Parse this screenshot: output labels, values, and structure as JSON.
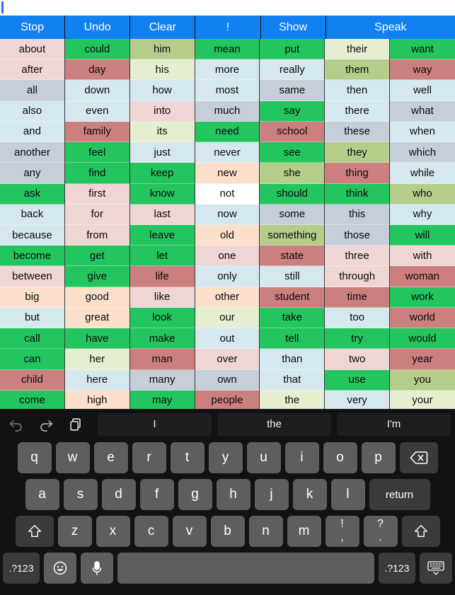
{
  "textentry": {
    "value": "",
    "placeholder": ""
  },
  "commandbar": {
    "buttons": [
      {
        "label": "Stop",
        "name": "stop",
        "flex": 1
      },
      {
        "label": "Undo",
        "name": "undo",
        "flex": 1
      },
      {
        "label": "Clear",
        "name": "clear",
        "flex": 1
      },
      {
        "label": "!",
        "name": "exclaim",
        "flex": 1
      },
      {
        "label": "Show",
        "name": "show",
        "flex": 1
      },
      {
        "label": "Speak",
        "name": "speak",
        "flex": 2
      }
    ],
    "background": "#1180f0",
    "text_color": "#ffffff"
  },
  "palette": {
    "green": "#22c55e",
    "olive": "#b5cd8a",
    "paleyellow": "#e6eed0",
    "paleblue": "#d6e8ef",
    "bluegray": "#c5ced9",
    "pink": "#f0d5d5",
    "rose": "#cc7f7f",
    "peach": "#fce0cc",
    "white": "#ffffff"
  },
  "grid": {
    "columns": [
      {
        "cells": [
          {
            "w": "about",
            "c": "pink"
          },
          {
            "w": "after",
            "c": "pink"
          },
          {
            "w": "all",
            "c": "bluegray"
          },
          {
            "w": "also",
            "c": "paleblue"
          },
          {
            "w": "and",
            "c": "paleblue"
          },
          {
            "w": "another",
            "c": "bluegray"
          },
          {
            "w": "any",
            "c": "bluegray"
          },
          {
            "w": "ask",
            "c": "green"
          },
          {
            "w": "back",
            "c": "paleblue"
          },
          {
            "w": "because",
            "c": "paleblue"
          },
          {
            "w": "become",
            "c": "green"
          },
          {
            "w": "between",
            "c": "pink"
          },
          {
            "w": "big",
            "c": "peach"
          },
          {
            "w": "but",
            "c": "paleblue"
          },
          {
            "w": "call",
            "c": "green"
          },
          {
            "w": "can",
            "c": "green"
          },
          {
            "w": "child",
            "c": "rose"
          },
          {
            "w": "come",
            "c": "green"
          }
        ]
      },
      {
        "cells": [
          {
            "w": "could",
            "c": "green"
          },
          {
            "w": "day",
            "c": "rose"
          },
          {
            "w": "down",
            "c": "paleblue"
          },
          {
            "w": "even",
            "c": "paleblue"
          },
          {
            "w": "family",
            "c": "rose"
          },
          {
            "w": "feel",
            "c": "green"
          },
          {
            "w": "find",
            "c": "green"
          },
          {
            "w": "first",
            "c": "pink"
          },
          {
            "w": "for",
            "c": "pink"
          },
          {
            "w": "from",
            "c": "pink"
          },
          {
            "w": "get",
            "c": "green"
          },
          {
            "w": "give",
            "c": "green"
          },
          {
            "w": "good",
            "c": "peach"
          },
          {
            "w": "great",
            "c": "peach"
          },
          {
            "w": "have",
            "c": "green"
          },
          {
            "w": "her",
            "c": "paleyellow"
          },
          {
            "w": "here",
            "c": "paleblue"
          },
          {
            "w": "high",
            "c": "peach"
          }
        ]
      },
      {
        "cells": [
          {
            "w": "him",
            "c": "olive"
          },
          {
            "w": "his",
            "c": "paleyellow"
          },
          {
            "w": "how",
            "c": "paleblue"
          },
          {
            "w": "into",
            "c": "pink"
          },
          {
            "w": "its",
            "c": "paleyellow"
          },
          {
            "w": "just",
            "c": "paleblue"
          },
          {
            "w": "keep",
            "c": "green"
          },
          {
            "w": "know",
            "c": "green"
          },
          {
            "w": "last",
            "c": "pink"
          },
          {
            "w": "leave",
            "c": "green"
          },
          {
            "w": "let",
            "c": "green"
          },
          {
            "w": "life",
            "c": "rose"
          },
          {
            "w": "like",
            "c": "pink"
          },
          {
            "w": "look",
            "c": "green"
          },
          {
            "w": "make",
            "c": "green"
          },
          {
            "w": "man",
            "c": "rose"
          },
          {
            "w": "many",
            "c": "bluegray"
          },
          {
            "w": "may",
            "c": "green"
          }
        ]
      },
      {
        "cells": [
          {
            "w": "mean",
            "c": "green"
          },
          {
            "w": "more",
            "c": "paleblue"
          },
          {
            "w": "most",
            "c": "paleblue"
          },
          {
            "w": "much",
            "c": "bluegray"
          },
          {
            "w": "need",
            "c": "green"
          },
          {
            "w": "never",
            "c": "paleblue"
          },
          {
            "w": "new",
            "c": "peach"
          },
          {
            "w": "not",
            "c": "white"
          },
          {
            "w": "now",
            "c": "paleblue"
          },
          {
            "w": "old",
            "c": "peach"
          },
          {
            "w": "one",
            "c": "pink"
          },
          {
            "w": "only",
            "c": "paleblue"
          },
          {
            "w": "other",
            "c": "peach"
          },
          {
            "w": "our",
            "c": "paleyellow"
          },
          {
            "w": "out",
            "c": "paleblue"
          },
          {
            "w": "over",
            "c": "pink"
          },
          {
            "w": "own",
            "c": "bluegray"
          },
          {
            "w": "people",
            "c": "rose"
          }
        ]
      },
      {
        "cells": [
          {
            "w": "put",
            "c": "green"
          },
          {
            "w": "really",
            "c": "paleblue"
          },
          {
            "w": "same",
            "c": "bluegray"
          },
          {
            "w": "say",
            "c": "green"
          },
          {
            "w": "school",
            "c": "rose"
          },
          {
            "w": "see",
            "c": "green"
          },
          {
            "w": "she",
            "c": "olive"
          },
          {
            "w": "should",
            "c": "green"
          },
          {
            "w": "some",
            "c": "bluegray"
          },
          {
            "w": "something",
            "c": "olive"
          },
          {
            "w": "state",
            "c": "rose"
          },
          {
            "w": "still",
            "c": "paleblue"
          },
          {
            "w": "student",
            "c": "rose"
          },
          {
            "w": "take",
            "c": "green"
          },
          {
            "w": "tell",
            "c": "green"
          },
          {
            "w": "than",
            "c": "paleblue"
          },
          {
            "w": "that",
            "c": "paleblue"
          },
          {
            "w": "the",
            "c": "paleyellow"
          }
        ]
      },
      {
        "cells": [
          {
            "w": "their",
            "c": "paleyellow"
          },
          {
            "w": "them",
            "c": "olive"
          },
          {
            "w": "then",
            "c": "paleblue"
          },
          {
            "w": "there",
            "c": "paleblue"
          },
          {
            "w": "these",
            "c": "bluegray"
          },
          {
            "w": "they",
            "c": "olive"
          },
          {
            "w": "thing",
            "c": "rose"
          },
          {
            "w": "think",
            "c": "green"
          },
          {
            "w": "this",
            "c": "bluegray"
          },
          {
            "w": "those",
            "c": "bluegray"
          },
          {
            "w": "three",
            "c": "pink"
          },
          {
            "w": "through",
            "c": "pink"
          },
          {
            "w": "time",
            "c": "rose"
          },
          {
            "w": "too",
            "c": "paleblue"
          },
          {
            "w": "try",
            "c": "green"
          },
          {
            "w": "two",
            "c": "pink"
          },
          {
            "w": "use",
            "c": "green"
          },
          {
            "w": "very",
            "c": "paleblue"
          }
        ]
      },
      {
        "cells": [
          {
            "w": "want",
            "c": "green"
          },
          {
            "w": "way",
            "c": "rose"
          },
          {
            "w": "well",
            "c": "paleblue"
          },
          {
            "w": "what",
            "c": "bluegray"
          },
          {
            "w": "when",
            "c": "paleblue"
          },
          {
            "w": "which",
            "c": "bluegray"
          },
          {
            "w": "while",
            "c": "paleblue"
          },
          {
            "w": "who",
            "c": "olive"
          },
          {
            "w": "why",
            "c": "paleblue"
          },
          {
            "w": "will",
            "c": "green"
          },
          {
            "w": "with",
            "c": "pink"
          },
          {
            "w": "woman",
            "c": "rose"
          },
          {
            "w": "work",
            "c": "green"
          },
          {
            "w": "world",
            "c": "rose"
          },
          {
            "w": "would",
            "c": "green"
          },
          {
            "w": "year",
            "c": "rose"
          },
          {
            "w": "you",
            "c": "olive"
          },
          {
            "w": "your",
            "c": "paleyellow"
          }
        ]
      }
    ]
  },
  "keyboard": {
    "tools": [
      {
        "name": "undo-icon",
        "label": "undo"
      },
      {
        "name": "redo-icon",
        "label": "redo"
      },
      {
        "name": "paste-icon",
        "label": "paste"
      }
    ],
    "predictions": [
      "I",
      "the",
      "I'm"
    ],
    "row1": [
      "q",
      "w",
      "e",
      "r",
      "t",
      "y",
      "u",
      "i",
      "o",
      "p"
    ],
    "row2": [
      "a",
      "s",
      "d",
      "f",
      "g",
      "h",
      "j",
      "k",
      "l"
    ],
    "return_label": "return",
    "row3": [
      "z",
      "x",
      "c",
      "v",
      "b",
      "n",
      "m"
    ],
    "punct1": {
      "top": "!",
      "bottom": ","
    },
    "punct2": {
      "top": "?",
      "bottom": "."
    },
    "numeric_label": ".?123",
    "numeric_label_right": ".?123",
    "space_label": "",
    "backspace_name": "backspace-icon",
    "shift_left_name": "shift-icon",
    "shift_right_name": "shift-icon",
    "emoji_name": "emoji-icon",
    "mic_name": "microphone-icon",
    "dismiss_name": "dismiss-keyboard-icon"
  }
}
